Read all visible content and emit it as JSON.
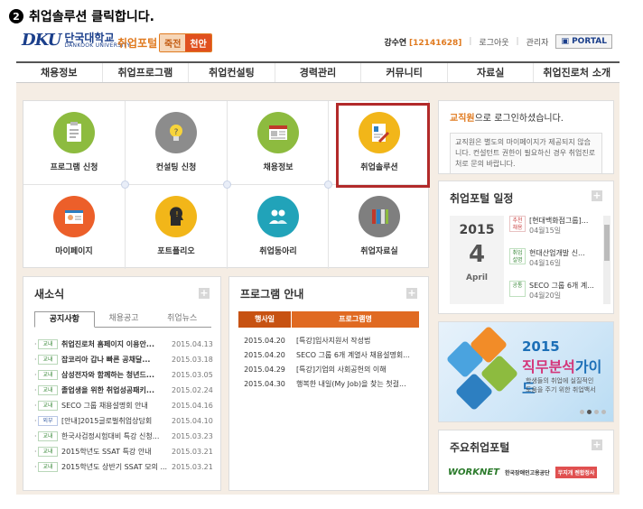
{
  "caption": {
    "num": "2",
    "text": "취업솔루션 클릭합니다."
  },
  "header": {
    "logo_mark": "DKU",
    "logo_ko": "단국대학교",
    "logo_en": "DANKOOK UNIVERSITY",
    "portal_title": "취업포털",
    "campus_jukjeon": "죽전",
    "campus_cheonan": "천안",
    "user_name": "강수연",
    "user_id": "[12141628]",
    "logout": "로그아웃",
    "admin": "관리자",
    "portal_button": "PORTAL"
  },
  "nav": [
    "채용정보",
    "취업프로그램",
    "취업컨설팅",
    "경력관리",
    "커뮤니티",
    "자료실",
    "취업진로처 소개"
  ],
  "menu": [
    {
      "label": "프로그램 신청",
      "color": "#8dbb3f",
      "icon": "clipboard-icon"
    },
    {
      "label": "컨설팅 신청",
      "color": "#8c8c8c",
      "icon": "lightbulb-icon"
    },
    {
      "label": "채용정보",
      "color": "#8dbb3f",
      "icon": "newspaper-icon"
    },
    {
      "label": "취업솔루션",
      "color": "#f2b619",
      "icon": "resume-pen-icon"
    },
    {
      "label": "마이페이지",
      "color": "#ec5f2a",
      "icon": "id-card-icon"
    },
    {
      "label": "포트폴리오",
      "color": "#f2b619",
      "icon": "head-profile-icon"
    },
    {
      "label": "취업동아리",
      "color": "#21a3b9",
      "icon": "people-icon"
    },
    {
      "label": "취업자료실",
      "color": "#7f7f7f",
      "icon": "books-icon"
    }
  ],
  "login": {
    "role": "교직원",
    "msg": "으로 로그인하셨습니다.",
    "notice": "교직원은 별도의 마이페이지가 제공되지 않습니다. 컨설턴트 권한이 필요하신 경우 취업진로처로 문의 바랍니다."
  },
  "schedule": {
    "title": "취업포털 일정",
    "year": "2015",
    "month": "4",
    "month_label": "April",
    "items": [
      {
        "tag": "추천채용",
        "title": "[현대백화점그룹]...",
        "date": "04월15일",
        "red": true
      },
      {
        "tag": "취업설명",
        "title": "현대산업개발 신...",
        "date": "04월16일",
        "red": false
      },
      {
        "tag": "공통",
        "title": "SECO 그룹 6개 계...",
        "date": "04월20일",
        "red": false
      }
    ]
  },
  "banner": {
    "year": "2015",
    "title_a": "직무분석",
    "title_b": "가이드",
    "sub1": "학생들의 취업에 실질적인",
    "sub2": "도움을 주기 위한 취업백서"
  },
  "sites": {
    "title": "주요취업포털",
    "worknet": "WORKNET",
    "kead": "한국장애인고용공단",
    "rainbow": "무지개 렌합정사"
  },
  "news": {
    "title": "새소식",
    "tabs": [
      "공지사항",
      "채용공고",
      "취업뉴스"
    ],
    "rows": [
      {
        "badge": "교내",
        "title": "취업진로처 홈페이지 이용안...",
        "date": "2015.04.13",
        "bold": true
      },
      {
        "badge": "교내",
        "title": "잡코리아 갑나 빠른 공채달...",
        "date": "2015.03.18",
        "bold": true
      },
      {
        "badge": "교내",
        "title": "삼성전자와 함께하는 청년드...",
        "date": "2015.03.05",
        "bold": true
      },
      {
        "badge": "교내",
        "title": "졸업생을 위한 취업성공패키...",
        "date": "2015.02.24",
        "bold": true
      },
      {
        "badge": "교내",
        "title": "SECO 그룹 채용설명회 안내",
        "date": "2015.04.16",
        "bold": false
      },
      {
        "badge": "외부",
        "title": "[안내]2015글로벌취업상담회",
        "date": "2015.04.10",
        "bold": false
      },
      {
        "badge": "교내",
        "title": "한국사검정시험대비 특강 신청...",
        "date": "2015.03.23",
        "bold": false
      },
      {
        "badge": "교내",
        "title": "2015학년도 SSAT 특강 안내",
        "date": "2015.03.21",
        "bold": false
      },
      {
        "badge": "교내",
        "title": "2015학년도 상반기 SSAT 모의 ...",
        "date": "2015.03.21",
        "bold": false
      }
    ]
  },
  "programs": {
    "title": "프로그램 안내",
    "head_date": "행사일",
    "head_name": "프로그램명",
    "rows": [
      {
        "date": "2015.04.20",
        "title": "[특강]입사지원서 작성법"
      },
      {
        "date": "2015.04.20",
        "title": "SECO 그룹 6개 계열사 채용설명회..."
      },
      {
        "date": "2015.04.29",
        "title": "[특강]기업의 사회공헌의 이해"
      },
      {
        "date": "2015.04.30",
        "title": "행복한 내일(My Job)을 찾는 첫걸..."
      }
    ]
  }
}
